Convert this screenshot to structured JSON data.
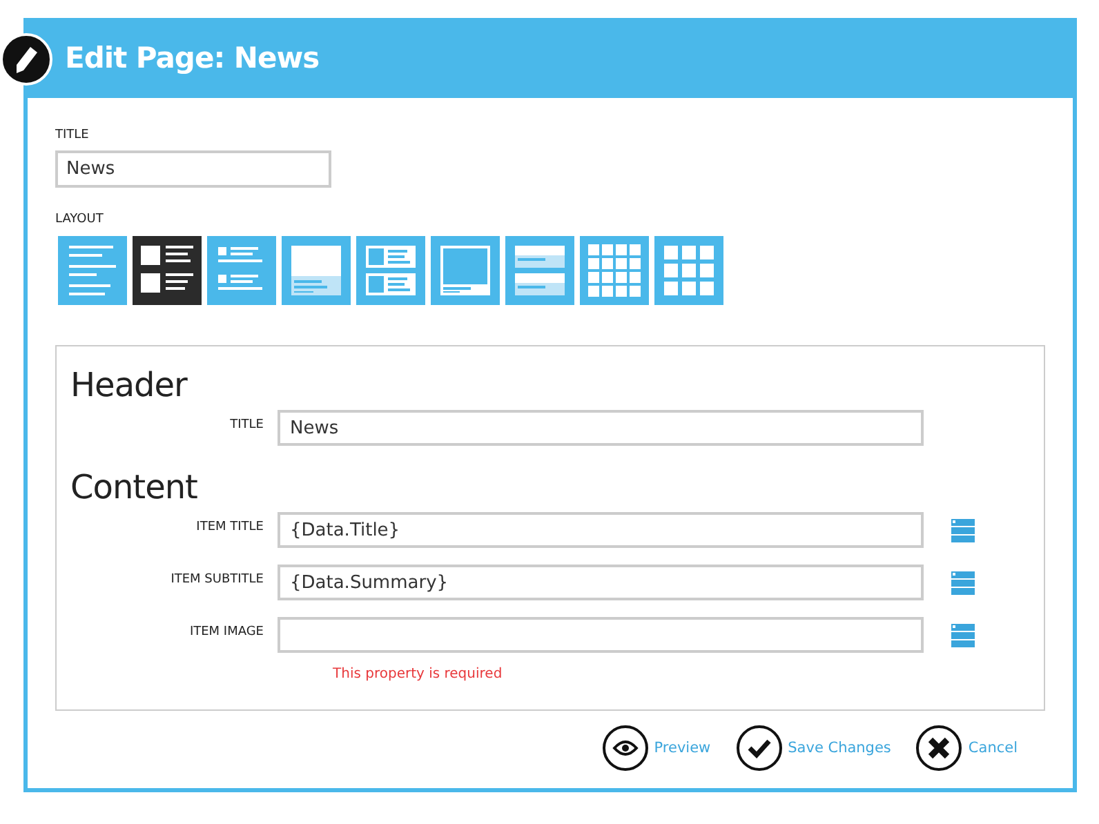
{
  "dialog": {
    "title": "Edit Page: News"
  },
  "title_field": {
    "label": "TITLE",
    "value": "News"
  },
  "layout": {
    "label": "LAYOUT",
    "options": [
      {
        "kind": "lines",
        "selected": false
      },
      {
        "kind": "thumb-list",
        "selected": true
      },
      {
        "kind": "small-thumb-list",
        "selected": false
      },
      {
        "kind": "hero",
        "selected": false
      },
      {
        "kind": "cards",
        "selected": false
      },
      {
        "kind": "picture",
        "selected": false
      },
      {
        "kind": "banners",
        "selected": false
      },
      {
        "kind": "grid-4",
        "selected": false
      },
      {
        "kind": "grid-3",
        "selected": false
      }
    ]
  },
  "sections": [
    {
      "heading": "Header",
      "fields": [
        {
          "label": "TITLE",
          "value": "News",
          "binding": false
        }
      ]
    },
    {
      "heading": "Content",
      "fields": [
        {
          "label": "ITEM TITLE",
          "value": "{Data.Title}",
          "binding": true
        },
        {
          "label": "ITEM SUBTITLE",
          "value": "{Data.Summary}",
          "binding": true
        },
        {
          "label": "ITEM IMAGE",
          "binding": true,
          "error": "This property is required"
        }
      ]
    }
  ],
  "actions": [
    {
      "kind": "preview",
      "label": "Preview"
    },
    {
      "kind": "save",
      "label": "Save Changes"
    },
    {
      "kind": "cancel",
      "label": "Cancel"
    }
  ]
}
